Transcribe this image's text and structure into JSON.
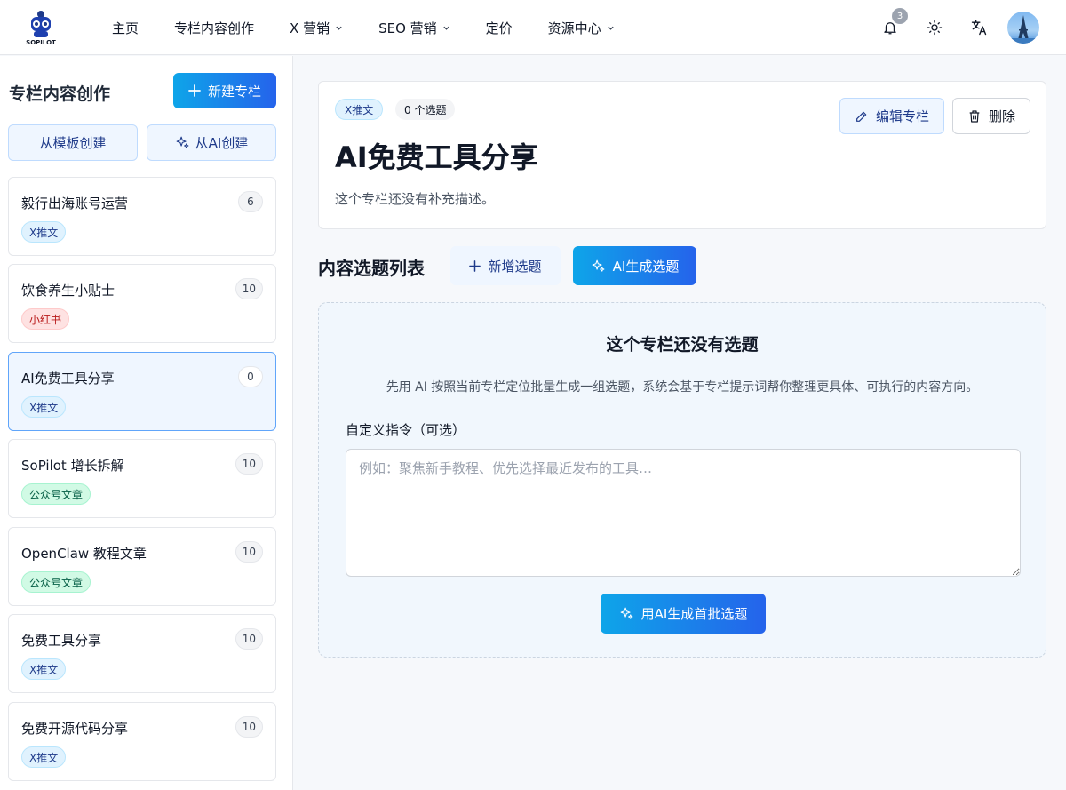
{
  "nav": {
    "logo_text": "SOPILOT",
    "items": [
      {
        "label": "主页",
        "dropdown": false
      },
      {
        "label": "专栏内容创作",
        "dropdown": false
      },
      {
        "label": "X 营销",
        "dropdown": true
      },
      {
        "label": "SEO 营销",
        "dropdown": true
      },
      {
        "label": "定价",
        "dropdown": false
      },
      {
        "label": "资源中心",
        "dropdown": true
      }
    ],
    "notification_count": "3"
  },
  "sidebar": {
    "title": "专栏内容创作",
    "new_button": "新建专栏",
    "template_button": "从模板创建",
    "ai_button": "从AI创建",
    "columns": [
      {
        "title": "毅行出海账号运营",
        "count": "6",
        "tag": "X推文",
        "tag_type": "x"
      },
      {
        "title": "饮食养生小贴士",
        "count": "10",
        "tag": "小红书",
        "tag_type": "red"
      },
      {
        "title": "AI免费工具分享",
        "count": "0",
        "tag": "X推文",
        "tag_type": "x",
        "active": true
      },
      {
        "title": "SoPilot 增长拆解",
        "count": "10",
        "tag": "公众号文章",
        "tag_type": "green"
      },
      {
        "title": "OpenClaw 教程文章",
        "count": "10",
        "tag": "公众号文章",
        "tag_type": "green"
      },
      {
        "title": "免费工具分享",
        "count": "10",
        "tag": "X推文",
        "tag_type": "x"
      },
      {
        "title": "免费开源代码分享",
        "count": "10",
        "tag": "X推文",
        "tag_type": "x"
      }
    ]
  },
  "header": {
    "platform_tag": "X推文",
    "topic_count": "0 个选题",
    "title": "AI免费工具分享",
    "description": "这个专栏还没有补充描述。",
    "edit_button": "编辑专栏",
    "delete_button": "删除"
  },
  "topics": {
    "title": "内容选题列表",
    "add_button": "新增选题",
    "ai_button": "AI生成选题"
  },
  "empty_state": {
    "title": "这个专栏还没有选题",
    "description": "先用 AI 按照当前专栏定位批量生成一组选题，系统会基于专栏提示词帮你整理更具体、可执行的内容方向。",
    "field_label": "自定义指令（可选）",
    "placeholder": "例如：聚焦新手教程、优先选择最近发布的工具…",
    "generate_button": "用AI生成首批选题"
  },
  "colors": {
    "accent_start": "#0ea5e9",
    "accent_end": "#2563eb",
    "active_card_bg": "#eff6ff"
  }
}
